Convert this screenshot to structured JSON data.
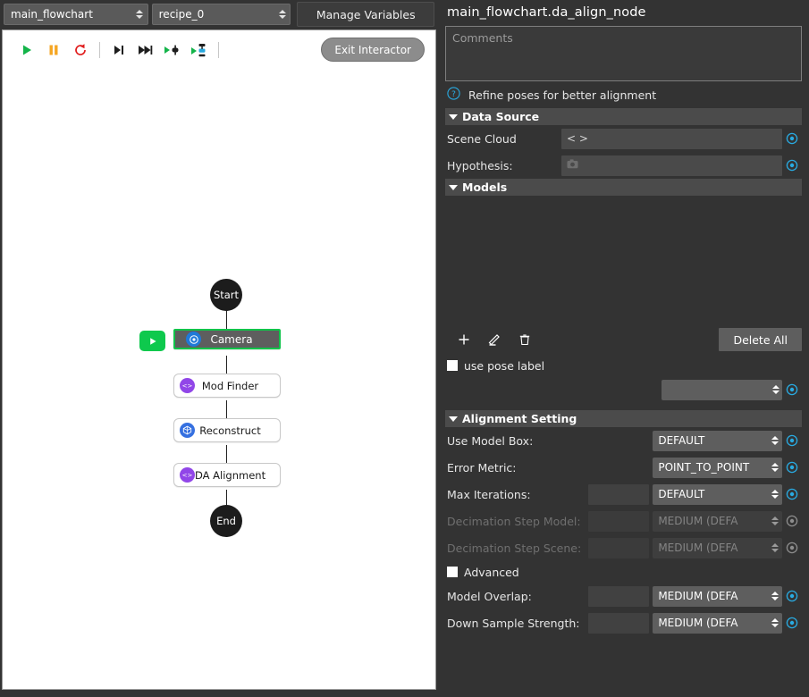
{
  "toolbar_top": {
    "flowchart_select": {
      "value": "main_flowchart",
      "name": "flowchart-select"
    },
    "recipe_select": {
      "value": "recipe_0",
      "name": "recipe-select"
    },
    "manage_variables_label": "Manage Variables"
  },
  "canvas_toolbar": {
    "buttons": [
      {
        "icon": "play-icon",
        "title": "Run"
      },
      {
        "icon": "pause-icon",
        "title": "Pause"
      },
      {
        "icon": "reload-icon",
        "title": "Reset"
      },
      {
        "icon": "step-over-icon",
        "title": "Step"
      },
      {
        "icon": "fast-forward-icon",
        "title": "Continue"
      },
      {
        "icon": "run-to-node-icon",
        "title": "Run To Node"
      },
      {
        "icon": "run-from-node-icon",
        "title": "Run From Node"
      }
    ],
    "exit_interactor_label": "Exit Interactor"
  },
  "flowchart": {
    "start_label": "Start",
    "end_label": "End",
    "nodes": [
      {
        "label": "Camera",
        "icon": "camera-node-icon",
        "icon_color": "#2079d8",
        "selected": true
      },
      {
        "label": "Mod Finder",
        "icon": "code-brackets-node-icon",
        "icon_color": "#9146e8",
        "selected": false
      },
      {
        "label": "Reconstruct",
        "icon": "cube-node-icon",
        "icon_color": "#3570e0",
        "selected": false
      },
      {
        "label": "DA Alignment",
        "icon": "code-brackets-node-icon",
        "icon_color": "#9146e8",
        "selected": false
      }
    ],
    "run_button_icon": "run-node-play-icon"
  },
  "panel": {
    "title": "main_flowchart.da_align_node",
    "comments_placeholder": "Comments",
    "hint_text": "Refine poses for better alignment",
    "hint_icon": "help-circle-icon",
    "sections": {
      "data_source": "Data Source",
      "models": "Models",
      "alignment_setting": "Alignment Setting"
    },
    "data_source": {
      "scene_cloud": {
        "label": "Scene Cloud",
        "value": "< >"
      },
      "hypothesis": {
        "label": "Hypothesis:",
        "value": "",
        "icon": "camera-small-icon"
      }
    },
    "models": {
      "add_icon": "plus-icon",
      "edit_icon": "pencil-icon",
      "delete_icon": "trash-icon",
      "delete_all_label": "Delete All",
      "use_pose_label": "use pose label",
      "pose_select_value": ""
    },
    "alignment": [
      {
        "label": "Use Model Box:",
        "select": "DEFAULT",
        "has_num": false,
        "disabled": false
      },
      {
        "label": "Error Metric:",
        "select": "POINT_TO_POINT",
        "has_num": false,
        "disabled": false
      },
      {
        "label": "Max Iterations:",
        "select": "DEFAULT",
        "has_num": true,
        "disabled": false
      },
      {
        "label": "Decimation Step Model:",
        "select": "MEDIUM (DEFA",
        "has_num": true,
        "disabled": true
      },
      {
        "label": "Decimation Step Scene:",
        "select": "MEDIUM (DEFA",
        "has_num": true,
        "disabled": true
      }
    ],
    "advanced_label": "Advanced",
    "alignment_advanced": [
      {
        "label": "Model Overlap:",
        "select": "MEDIUM (DEFA",
        "has_num": true,
        "disabled": false
      },
      {
        "label": "Down Sample Strength:",
        "select": "MEDIUM (DEFA",
        "has_num": true,
        "disabled": false
      }
    ],
    "reset_icon": "reset-to-default-icon"
  },
  "colors": {
    "accent_green": "#0ec94d",
    "accent_blue": "#29abe2",
    "highlight_red": "#ff1515",
    "panel_bg": "#333333"
  }
}
